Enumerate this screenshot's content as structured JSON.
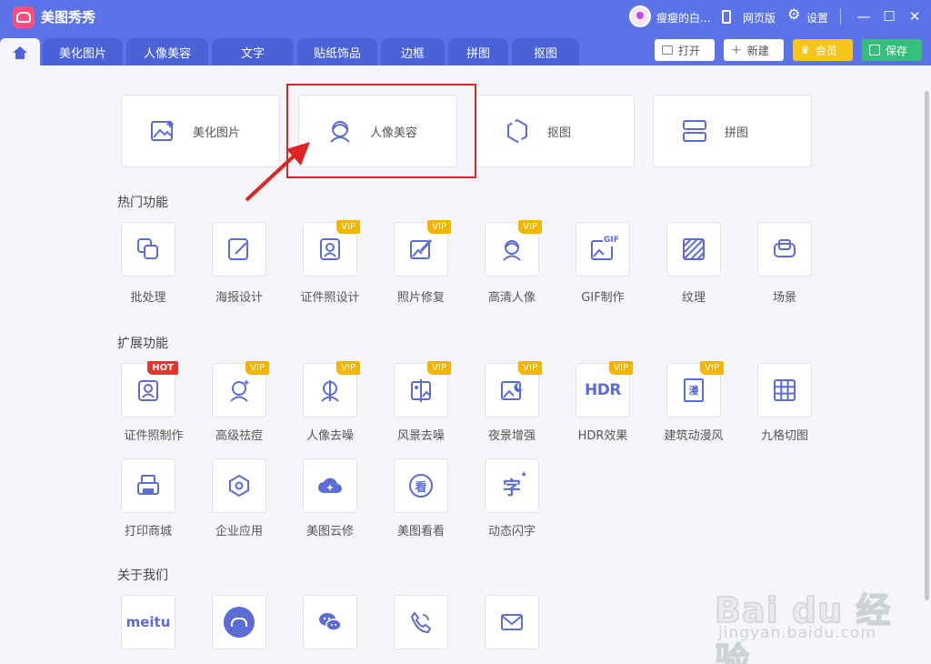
{
  "app": {
    "title": "美图秀秀"
  },
  "titlebar": {
    "username": "瘦瘦的白...",
    "web_version": "网页版",
    "settings": "设置",
    "minimize": "—",
    "maximize": "☐",
    "close": "✕"
  },
  "tabs": [
    "美化图片",
    "人像美容",
    "文字",
    "贴纸饰品",
    "边框",
    "拼图",
    "抠图"
  ],
  "actions": {
    "open": "打开",
    "new": "新建",
    "vip": "会员",
    "save": "保存"
  },
  "main_cards": [
    {
      "label": "美化图片",
      "icon": "beautify-image-icon"
    },
    {
      "label": "人像美容",
      "icon": "portrait-beauty-icon"
    },
    {
      "label": "抠图",
      "icon": "cutout-icon"
    },
    {
      "label": "拼图",
      "icon": "collage-icon"
    }
  ],
  "sections": {
    "hot": "热门功能",
    "ext": "扩展功能",
    "about": "关于我们"
  },
  "hot_items": [
    {
      "label": "批处理",
      "icon": "batch-icon",
      "badge": ""
    },
    {
      "label": "海报设计",
      "icon": "poster-icon",
      "badge": ""
    },
    {
      "label": "证件照设计",
      "icon": "id-photo-icon",
      "badge": "VIP"
    },
    {
      "label": "照片修复",
      "icon": "photo-repair-icon",
      "badge": "VIP"
    },
    {
      "label": "高清人像",
      "icon": "hd-portrait-icon",
      "badge": "VIP"
    },
    {
      "label": "GIF制作",
      "icon": "gif-icon",
      "badge": ""
    },
    {
      "label": "纹理",
      "icon": "texture-icon",
      "badge": ""
    },
    {
      "label": "场景",
      "icon": "scene-icon",
      "badge": ""
    }
  ],
  "ext_items": [
    {
      "label": "证件照制作",
      "icon": "id-photo-make-icon",
      "badge": "HOT"
    },
    {
      "label": "高级祛痘",
      "icon": "acne-removal-icon",
      "badge": "VIP"
    },
    {
      "label": "人像去噪",
      "icon": "portrait-denoise-icon",
      "badge": "VIP"
    },
    {
      "label": "风景去噪",
      "icon": "landscape-denoise-icon",
      "badge": "VIP"
    },
    {
      "label": "夜景增强",
      "icon": "night-enhance-icon",
      "badge": "VIP"
    },
    {
      "label": "HDR效果",
      "icon": "hdr-icon",
      "badge": "VIP"
    },
    {
      "label": "建筑动漫风",
      "icon": "anime-building-icon",
      "badge": "VIP"
    },
    {
      "label": "九格切图",
      "icon": "grid-cut-icon",
      "badge": ""
    },
    {
      "label": "打印商城",
      "icon": "print-shop-icon",
      "badge": ""
    },
    {
      "label": "企业应用",
      "icon": "enterprise-icon",
      "badge": ""
    },
    {
      "label": "美图云修",
      "icon": "cloud-retouch-icon",
      "badge": ""
    },
    {
      "label": "美图看看",
      "icon": "viewer-icon",
      "badge": ""
    },
    {
      "label": "动态闪字",
      "icon": "flash-text-icon",
      "badge": ""
    }
  ],
  "about_items": [
    {
      "label": "meitu",
      "icon": "meitu-logo-icon"
    },
    {
      "label": "",
      "icon": "web-version-icon"
    },
    {
      "label": "",
      "icon": "wechat-icon"
    },
    {
      "label": "",
      "icon": "phone-service-icon"
    },
    {
      "label": "",
      "icon": "mail-feedback-icon"
    }
  ],
  "hdr_text": "HDR",
  "gif_text": "GIF",
  "manga_char": "漫",
  "kan_char": "看",
  "zi_char": "字",
  "watermark": {
    "main": "Bai du 经验",
    "sub": "jingyan.baidu.com"
  },
  "colors": {
    "primary": "#5b73e8",
    "tab": "#4a62d6",
    "icon": "#5b6cd6",
    "vip": "#f4b400",
    "hot": "#e5342b",
    "highlight": "#e02424"
  }
}
